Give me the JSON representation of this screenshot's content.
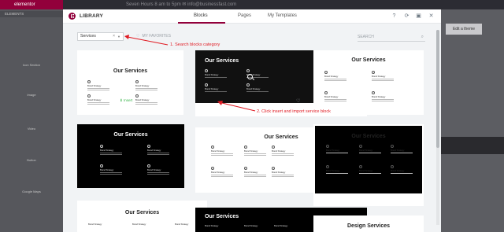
{
  "background": {
    "panel_header": "elementor",
    "panel_category": "ELEMENTS",
    "widgets": [
      "Icon Section",
      "Image",
      "Video",
      "Button",
      "Google Maps"
    ],
    "topbar": "Seven Hours 8 am to 5pm   ✉ info@businessfast.com",
    "right_button": "Edit a theme"
  },
  "modal": {
    "title": "LIBRARY",
    "tabs": [
      {
        "label": "Blocks",
        "active": true
      },
      {
        "label": "Pages",
        "active": false
      },
      {
        "label": "My Templates",
        "active": false
      }
    ],
    "filter_value": "Services",
    "favorites_label": "MY FAVORITES",
    "search_placeholder": "SEARCH",
    "insert_label": "Insert"
  },
  "cards": [
    {
      "title": "Our Services",
      "theme": "light"
    },
    {
      "title": "Our Services",
      "theme": "dark"
    },
    {
      "title": "Our Services",
      "theme": "light"
    },
    {
      "title": "Our Services",
      "theme": "dark"
    },
    {
      "title": "Our Services",
      "theme": "light"
    },
    {
      "title": "Our Services",
      "theme": "dark"
    },
    {
      "title": "Our Services",
      "theme": "light"
    },
    {
      "title": "Our Services",
      "theme": "dark"
    },
    {
      "title": "Design Services",
      "theme": "light"
    }
  ],
  "service_label": "Brand Strategy",
  "annotations": {
    "step1": "1. Search blocks category",
    "step2": "2. Click insert and import service block"
  },
  "colors": {
    "brand": "#92003b",
    "annotation": "#e01a22",
    "insert": "#39b54a"
  }
}
